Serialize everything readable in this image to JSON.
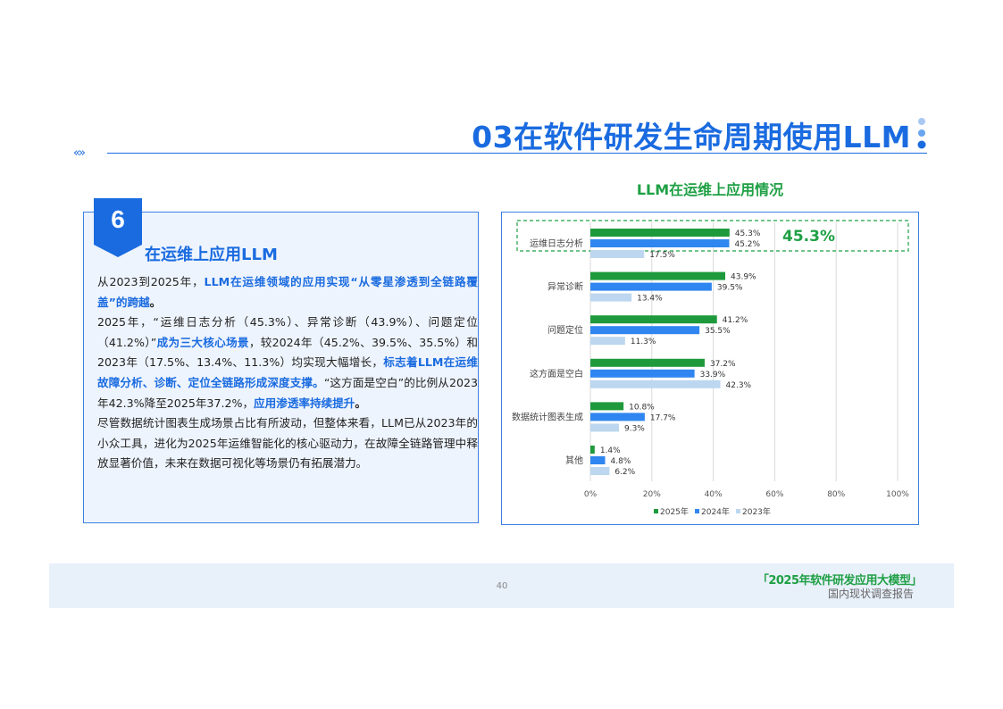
{
  "header": {
    "title": "03在软件研发生命周期使用LLM",
    "nav_arrows": "«»"
  },
  "section": {
    "number": "6",
    "heading": "在运维上应用LLM",
    "paragraphs": [
      [
        {
          "t": "从2023到2025年，",
          "s": "n"
        },
        {
          "t": "LLM在运维领域的应用实现“从零星渗透到全链路覆盖”的跨越",
          "s": "hl"
        },
        {
          "t": "。",
          "s": "bk"
        }
      ],
      [
        {
          "t": "2025年，“运维日志分析（45.3%）、异常诊断（43.9%）、问题定位（41.2%）”",
          "s": "n"
        },
        {
          "t": "成为三大核心场景",
          "s": "hl"
        },
        {
          "t": "，较2024年（45.2%、39.5%、35.5%）和2023年（17.5%、13.4%、11.3%）均实现大幅增长，",
          "s": "n"
        },
        {
          "t": "标志着LLM在运维故障分析、诊断、定位全链路形成深度支撑。",
          "s": "hl"
        },
        {
          "t": "“这方面是空白”的比例从2023年42.3%降至2025年37.2%，",
          "s": "n"
        },
        {
          "t": "应用渗透率持续提升",
          "s": "hl"
        },
        {
          "t": "。",
          "s": "bk"
        }
      ],
      [
        {
          "t": "尽管数据统计图表生成场景占比有所波动，但整体来看，LLM已从2023年的小众工具，进化为2025年运维智能化的核心驱动力，在故障全链路管理中释放显著价值，未来在数据可视化等场景仍有拓展潜力。",
          "s": "n"
        }
      ]
    ]
  },
  "chart_data": {
    "type": "bar",
    "orientation": "horizontal",
    "title": "LLM在运维上应用情况",
    "categories": [
      "运维日志分析",
      "异常诊断",
      "问题定位",
      "这方面是空白",
      "数据统计图表生成",
      "其他"
    ],
    "series": [
      {
        "name": "2025年",
        "color": "#1e9a3c",
        "values": [
          45.3,
          43.9,
          41.2,
          37.2,
          10.8,
          1.4
        ]
      },
      {
        "name": "2024年",
        "color": "#2f86f0",
        "values": [
          45.2,
          39.5,
          35.5,
          33.9,
          17.7,
          4.8
        ]
      },
      {
        "name": "2023年",
        "color": "#bcd7ef",
        "values": [
          17.5,
          13.4,
          11.3,
          42.3,
          9.3,
          6.2
        ]
      }
    ],
    "value_labels": [
      [
        "45.3%",
        "43.9%",
        "41.2%",
        "37.2%",
        "10.8%",
        "1.4%"
      ],
      [
        "45.2%",
        "39.5%",
        "35.5%",
        "33.9%",
        "17.7%",
        "4.8%"
      ],
      [
        "17.5%",
        "13.4%",
        "11.3%",
        "42.3%",
        "9.3%",
        "6.2%"
      ]
    ],
    "x_ticks": [
      "0%",
      "20%",
      "40%",
      "60%",
      "80%",
      "100%"
    ],
    "xlim": [
      0,
      100
    ],
    "grid": true,
    "legend_position": "bottom",
    "highlight": {
      "category": "运维日志分析",
      "label": "45.3%",
      "color": "#1fa045"
    }
  },
  "footer": {
    "page_number": "40",
    "brand": "「2025年软件研发应用大模型」",
    "subtitle": "国内现状调查报告"
  }
}
